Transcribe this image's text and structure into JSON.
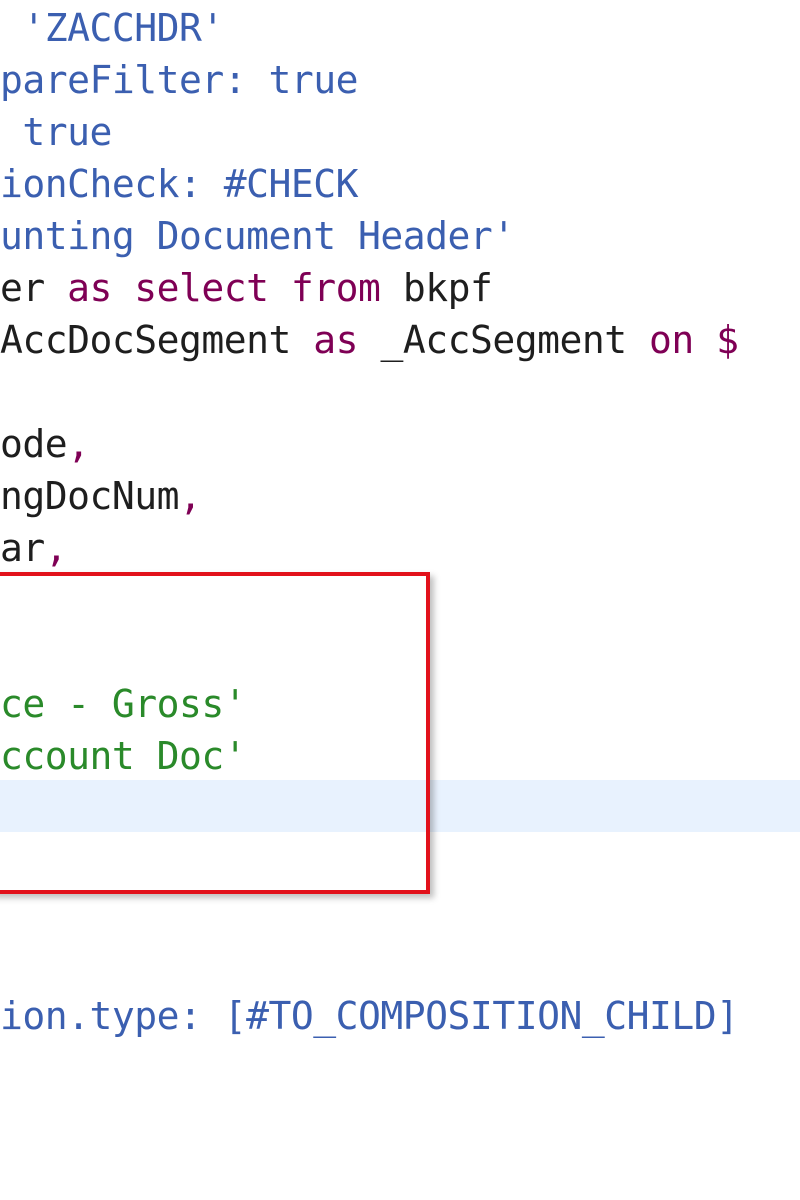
{
  "editor": {
    "lines": [
      {
        "tokens": [
          {
            "text": " 'ZACCHDR'",
            "kind": "str"
          }
        ]
      },
      {
        "tokens": [
          {
            "text": "pareFilter: true",
            "kind": "str"
          }
        ]
      },
      {
        "tokens": [
          {
            "text": " true",
            "kind": "str"
          }
        ]
      },
      {
        "tokens": [
          {
            "text": "ionCheck: #CHECK",
            "kind": "str"
          }
        ]
      },
      {
        "tokens": [
          {
            "text": "unting Document Header'",
            "kind": "str"
          }
        ]
      },
      {
        "tokens": [
          {
            "text": "er ",
            "kind": "plain"
          },
          {
            "text": "as select from",
            "kind": "kw"
          },
          {
            "text": " bkpf",
            "kind": "plain"
          }
        ]
      },
      {
        "tokens": [
          {
            "text": "AccDocSegment ",
            "kind": "plain"
          },
          {
            "text": "as",
            "kind": "kw"
          },
          {
            "text": " _AccSegment ",
            "kind": "plain"
          },
          {
            "text": "on $",
            "kind": "kw"
          }
        ]
      },
      {
        "tokens": []
      },
      {
        "tokens": [
          {
            "text": "ode",
            "kind": "plain"
          },
          {
            "text": ",",
            "kind": "kw"
          }
        ]
      },
      {
        "tokens": [
          {
            "text": "ngDocNum",
            "kind": "plain"
          },
          {
            "text": ",",
            "kind": "kw"
          }
        ]
      },
      {
        "tokens": [
          {
            "text": "ar",
            "kind": "plain"
          },
          {
            "text": ",",
            "kind": "kw"
          }
        ]
      },
      {
        "tokens": []
      },
      {
        "tokens": []
      },
      {
        "tokens": [
          {
            "text": "ce - Gross'",
            "kind": "green"
          }
        ]
      },
      {
        "tokens": [
          {
            "text": "ccount Doc'",
            "kind": "green"
          }
        ]
      },
      {
        "tokens": []
      },
      {
        "tokens": []
      },
      {
        "tokens": []
      },
      {
        "tokens": []
      },
      {
        "tokens": [
          {
            "text": "ion.type: [#TO_COMPOSITION_CHILD]",
            "kind": "str"
          }
        ]
      }
    ]
  },
  "colors": {
    "highlight_box_border": "#e2111b",
    "current_line_bg": "#e8f2fe",
    "string": "#3b5fb0",
    "keyword": "#7f0055",
    "plain": "#1e1e1e",
    "green_string": "#2a8a2a"
  }
}
